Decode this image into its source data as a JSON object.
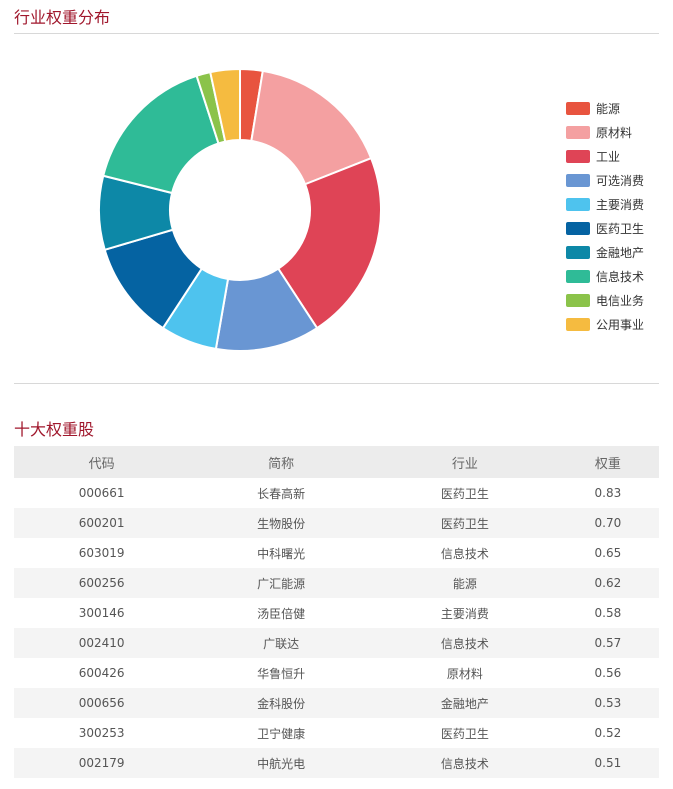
{
  "section1": {
    "title": "行业权重分布"
  },
  "section2": {
    "title": "十大权重股"
  },
  "chart_data": {
    "type": "pie",
    "donut": true,
    "legend_position": "right",
    "categories": [
      "能源",
      "原材料",
      "工业",
      "可选消费",
      "主要消费",
      "医药卫生",
      "金融地产",
      "信息技术",
      "电信业务",
      "公用事业"
    ],
    "values": [
      2.6,
      16.5,
      21.9,
      12.0,
      6.5,
      11.3,
      8.5,
      16.2,
      1.6,
      3.4
    ],
    "colors": [
      "#e8543f",
      "#f4a0a1",
      "#df4456",
      "#6996d3",
      "#4ec3ee",
      "#0563a2",
      "#0d88a7",
      "#2fbb97",
      "#8bc34a",
      "#f5bb40"
    ]
  },
  "table": {
    "headers": [
      "代码",
      "简称",
      "行业",
      "权重"
    ],
    "rows": [
      [
        "000661",
        "长春高新",
        "医药卫生",
        "0.83"
      ],
      [
        "600201",
        "生物股份",
        "医药卫生",
        "0.70"
      ],
      [
        "603019",
        "中科曙光",
        "信息技术",
        "0.65"
      ],
      [
        "600256",
        "广汇能源",
        "能源",
        "0.62"
      ],
      [
        "300146",
        "汤臣倍健",
        "主要消费",
        "0.58"
      ],
      [
        "002410",
        "广联达",
        "信息技术",
        "0.57"
      ],
      [
        "600426",
        "华鲁恒升",
        "原材料",
        "0.56"
      ],
      [
        "000656",
        "金科股份",
        "金融地产",
        "0.53"
      ],
      [
        "300253",
        "卫宁健康",
        "医药卫生",
        "0.52"
      ],
      [
        "002179",
        "中航光电",
        "信息技术",
        "0.51"
      ]
    ]
  }
}
